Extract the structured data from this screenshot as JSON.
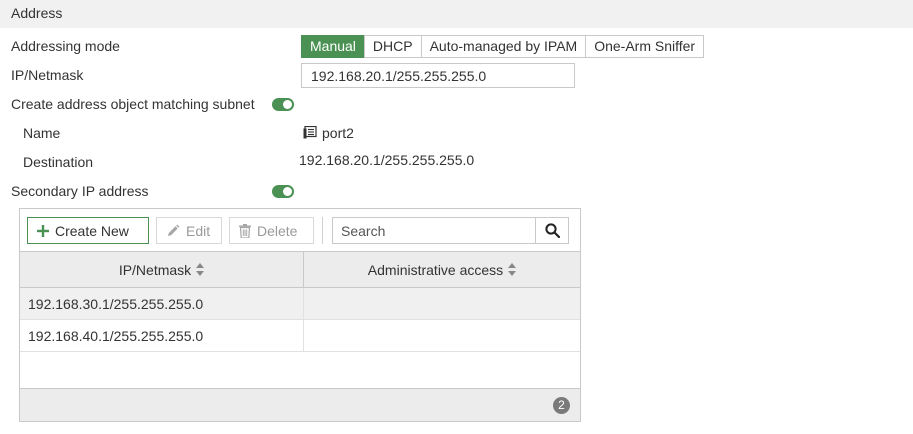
{
  "section": {
    "title": "Address"
  },
  "addressing_mode": {
    "label": "Addressing mode",
    "options": [
      "Manual",
      "DHCP",
      "Auto-managed by IPAM",
      "One-Arm Sniffer"
    ],
    "selected": "Manual"
  },
  "ip_netmask": {
    "label": "IP/Netmask",
    "value": "192.168.20.1/255.255.255.0"
  },
  "create_address_object": {
    "label": "Create address object matching subnet",
    "enabled": true
  },
  "address_object": {
    "name_label": "Name",
    "name_value": "port2",
    "destination_label": "Destination",
    "destination_value": "192.168.20.1/255.255.255.0"
  },
  "secondary_ip": {
    "label": "Secondary IP address",
    "enabled": true
  },
  "toolbar": {
    "create_new": "Create New",
    "edit": "Edit",
    "delete": "Delete",
    "search_placeholder": "Search"
  },
  "table": {
    "columns": [
      "IP/Netmask",
      "Administrative access"
    ],
    "rows": [
      {
        "ip": "192.168.30.1/255.255.255.0",
        "access": ""
      },
      {
        "ip": "192.168.40.1/255.255.255.0",
        "access": ""
      }
    ],
    "count": "2"
  },
  "colors": {
    "accent": "#4a9153",
    "header_bg": "#f1f1f1",
    "grid_bg": "#ececec"
  },
  "icons": [
    "plus-icon",
    "pencil-icon",
    "trash-icon",
    "search-icon",
    "sort-icon",
    "interface-icon"
  ]
}
